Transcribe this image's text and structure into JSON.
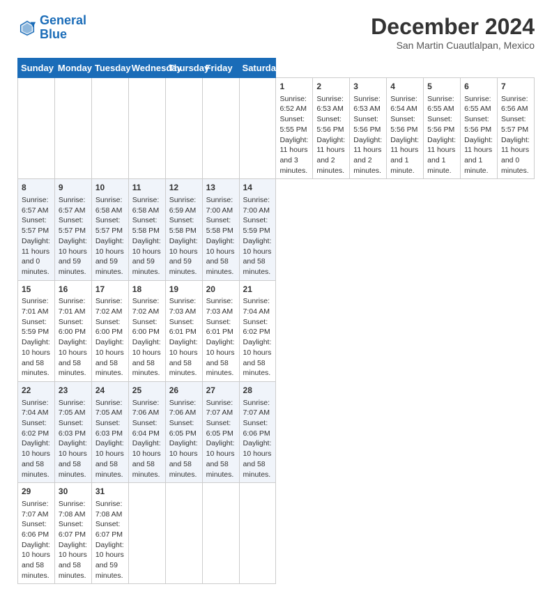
{
  "header": {
    "logo_line1": "General",
    "logo_line2": "Blue",
    "title": "December 2024",
    "subtitle": "San Martin Cuautlalpan, Mexico"
  },
  "calendar": {
    "days_of_week": [
      "Sunday",
      "Monday",
      "Tuesday",
      "Wednesday",
      "Thursday",
      "Friday",
      "Saturday"
    ],
    "weeks": [
      [
        null,
        null,
        null,
        null,
        null,
        null,
        null,
        {
          "day": "1",
          "sunrise": "Sunrise: 6:52 AM",
          "sunset": "Sunset: 5:55 PM",
          "daylight": "Daylight: 11 hours and 3 minutes."
        },
        {
          "day": "2",
          "sunrise": "Sunrise: 6:53 AM",
          "sunset": "Sunset: 5:56 PM",
          "daylight": "Daylight: 11 hours and 2 minutes."
        },
        {
          "day": "3",
          "sunrise": "Sunrise: 6:53 AM",
          "sunset": "Sunset: 5:56 PM",
          "daylight": "Daylight: 11 hours and 2 minutes."
        },
        {
          "day": "4",
          "sunrise": "Sunrise: 6:54 AM",
          "sunset": "Sunset: 5:56 PM",
          "daylight": "Daylight: 11 hours and 1 minute."
        },
        {
          "day": "5",
          "sunrise": "Sunrise: 6:55 AM",
          "sunset": "Sunset: 5:56 PM",
          "daylight": "Daylight: 11 hours and 1 minute."
        },
        {
          "day": "6",
          "sunrise": "Sunrise: 6:55 AM",
          "sunset": "Sunset: 5:56 PM",
          "daylight": "Daylight: 11 hours and 1 minute."
        },
        {
          "day": "7",
          "sunrise": "Sunrise: 6:56 AM",
          "sunset": "Sunset: 5:57 PM",
          "daylight": "Daylight: 11 hours and 0 minutes."
        }
      ],
      [
        {
          "day": "8",
          "sunrise": "Sunrise: 6:57 AM",
          "sunset": "Sunset: 5:57 PM",
          "daylight": "Daylight: 11 hours and 0 minutes."
        },
        {
          "day": "9",
          "sunrise": "Sunrise: 6:57 AM",
          "sunset": "Sunset: 5:57 PM",
          "daylight": "Daylight: 10 hours and 59 minutes."
        },
        {
          "day": "10",
          "sunrise": "Sunrise: 6:58 AM",
          "sunset": "Sunset: 5:57 PM",
          "daylight": "Daylight: 10 hours and 59 minutes."
        },
        {
          "day": "11",
          "sunrise": "Sunrise: 6:58 AM",
          "sunset": "Sunset: 5:58 PM",
          "daylight": "Daylight: 10 hours and 59 minutes."
        },
        {
          "day": "12",
          "sunrise": "Sunrise: 6:59 AM",
          "sunset": "Sunset: 5:58 PM",
          "daylight": "Daylight: 10 hours and 59 minutes."
        },
        {
          "day": "13",
          "sunrise": "Sunrise: 7:00 AM",
          "sunset": "Sunset: 5:58 PM",
          "daylight": "Daylight: 10 hours and 58 minutes."
        },
        {
          "day": "14",
          "sunrise": "Sunrise: 7:00 AM",
          "sunset": "Sunset: 5:59 PM",
          "daylight": "Daylight: 10 hours and 58 minutes."
        }
      ],
      [
        {
          "day": "15",
          "sunrise": "Sunrise: 7:01 AM",
          "sunset": "Sunset: 5:59 PM",
          "daylight": "Daylight: 10 hours and 58 minutes."
        },
        {
          "day": "16",
          "sunrise": "Sunrise: 7:01 AM",
          "sunset": "Sunset: 6:00 PM",
          "daylight": "Daylight: 10 hours and 58 minutes."
        },
        {
          "day": "17",
          "sunrise": "Sunrise: 7:02 AM",
          "sunset": "Sunset: 6:00 PM",
          "daylight": "Daylight: 10 hours and 58 minutes."
        },
        {
          "day": "18",
          "sunrise": "Sunrise: 7:02 AM",
          "sunset": "Sunset: 6:00 PM",
          "daylight": "Daylight: 10 hours and 58 minutes."
        },
        {
          "day": "19",
          "sunrise": "Sunrise: 7:03 AM",
          "sunset": "Sunset: 6:01 PM",
          "daylight": "Daylight: 10 hours and 58 minutes."
        },
        {
          "day": "20",
          "sunrise": "Sunrise: 7:03 AM",
          "sunset": "Sunset: 6:01 PM",
          "daylight": "Daylight: 10 hours and 58 minutes."
        },
        {
          "day": "21",
          "sunrise": "Sunrise: 7:04 AM",
          "sunset": "Sunset: 6:02 PM",
          "daylight": "Daylight: 10 hours and 58 minutes."
        }
      ],
      [
        {
          "day": "22",
          "sunrise": "Sunrise: 7:04 AM",
          "sunset": "Sunset: 6:02 PM",
          "daylight": "Daylight: 10 hours and 58 minutes."
        },
        {
          "day": "23",
          "sunrise": "Sunrise: 7:05 AM",
          "sunset": "Sunset: 6:03 PM",
          "daylight": "Daylight: 10 hours and 58 minutes."
        },
        {
          "day": "24",
          "sunrise": "Sunrise: 7:05 AM",
          "sunset": "Sunset: 6:03 PM",
          "daylight": "Daylight: 10 hours and 58 minutes."
        },
        {
          "day": "25",
          "sunrise": "Sunrise: 7:06 AM",
          "sunset": "Sunset: 6:04 PM",
          "daylight": "Daylight: 10 hours and 58 minutes."
        },
        {
          "day": "26",
          "sunrise": "Sunrise: 7:06 AM",
          "sunset": "Sunset: 6:05 PM",
          "daylight": "Daylight: 10 hours and 58 minutes."
        },
        {
          "day": "27",
          "sunrise": "Sunrise: 7:07 AM",
          "sunset": "Sunset: 6:05 PM",
          "daylight": "Daylight: 10 hours and 58 minutes."
        },
        {
          "day": "28",
          "sunrise": "Sunrise: 7:07 AM",
          "sunset": "Sunset: 6:06 PM",
          "daylight": "Daylight: 10 hours and 58 minutes."
        }
      ],
      [
        {
          "day": "29",
          "sunrise": "Sunrise: 7:07 AM",
          "sunset": "Sunset: 6:06 PM",
          "daylight": "Daylight: 10 hours and 58 minutes."
        },
        {
          "day": "30",
          "sunrise": "Sunrise: 7:08 AM",
          "sunset": "Sunset: 6:07 PM",
          "daylight": "Daylight: 10 hours and 58 minutes."
        },
        {
          "day": "31",
          "sunrise": "Sunrise: 7:08 AM",
          "sunset": "Sunset: 6:07 PM",
          "daylight": "Daylight: 10 hours and 59 minutes."
        },
        null,
        null,
        null,
        null
      ]
    ]
  }
}
